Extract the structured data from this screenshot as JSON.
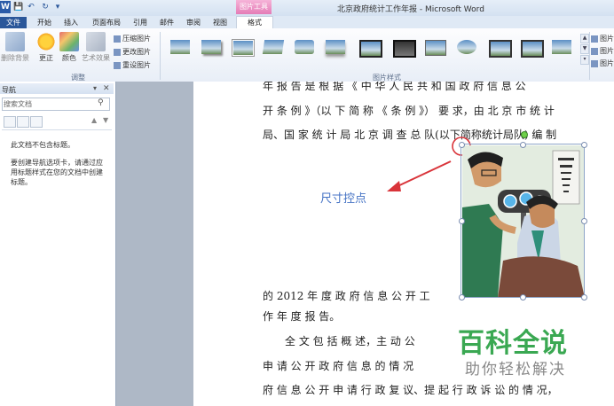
{
  "window": {
    "title": "北京政府统计工作年报 - Microsoft Word",
    "app_icon": "W"
  },
  "ribbon_tabs": {
    "tools_label": "图片工具",
    "file": "文件",
    "home": "开始",
    "insert": "插入",
    "layout": "页面布局",
    "references": "引用",
    "mailings": "邮件",
    "review": "审阅",
    "view": "视图",
    "format": "格式"
  },
  "adjust_group": {
    "remove_bg": "删除背景",
    "corrections": "更正",
    "color": "颜色",
    "artistic": "艺术效果",
    "compress": "压缩图片",
    "change": "更改图片",
    "reset": "重设图片",
    "label": "调整"
  },
  "styles_group": {
    "label": "图片样式"
  },
  "right_group": {
    "item1": "图片",
    "item2": "图片",
    "item3": "图片"
  },
  "nav": {
    "title": "导航",
    "search_placeholder": "搜索文档",
    "msg1": "此文档不包含标题。",
    "msg2": "要创建导航选项卡，请通过应用标题样式在您的文档中创建标题。"
  },
  "doc": {
    "line0": "年 报 告 是 根 据 《 中 华 人 民 共 和 国 政 府 信 息 公",
    "line1": "开 条 例 》（以 下 简 称 《 条 例 》） 要 求，由 北 京 市 统 计",
    "line2": "局、国 家 统 计 局 北 京 调 查 总 队(以下简称统计局队) 编 制",
    "line3": "的 2012 年 度 政 府 信 息 公 开 工",
    "line4": "作 年 度 报 告。",
    "line5": "全 文 包 括 概 述，主 动 公",
    "line6": "申 请 公 开 政 府 信 息 的 情 况",
    "line7": "府 信 息 公 开 申 请 行 政 复 议、提 起 行 政 诉 讼 的 情 况，",
    "annotation": "尺寸控点"
  },
  "watermark": {
    "main": "百科全说",
    "sub": "助你轻松解决"
  },
  "colors": {
    "accent": "#4472c4",
    "arrow": "#d9343a",
    "watermark": "#3aa852"
  }
}
